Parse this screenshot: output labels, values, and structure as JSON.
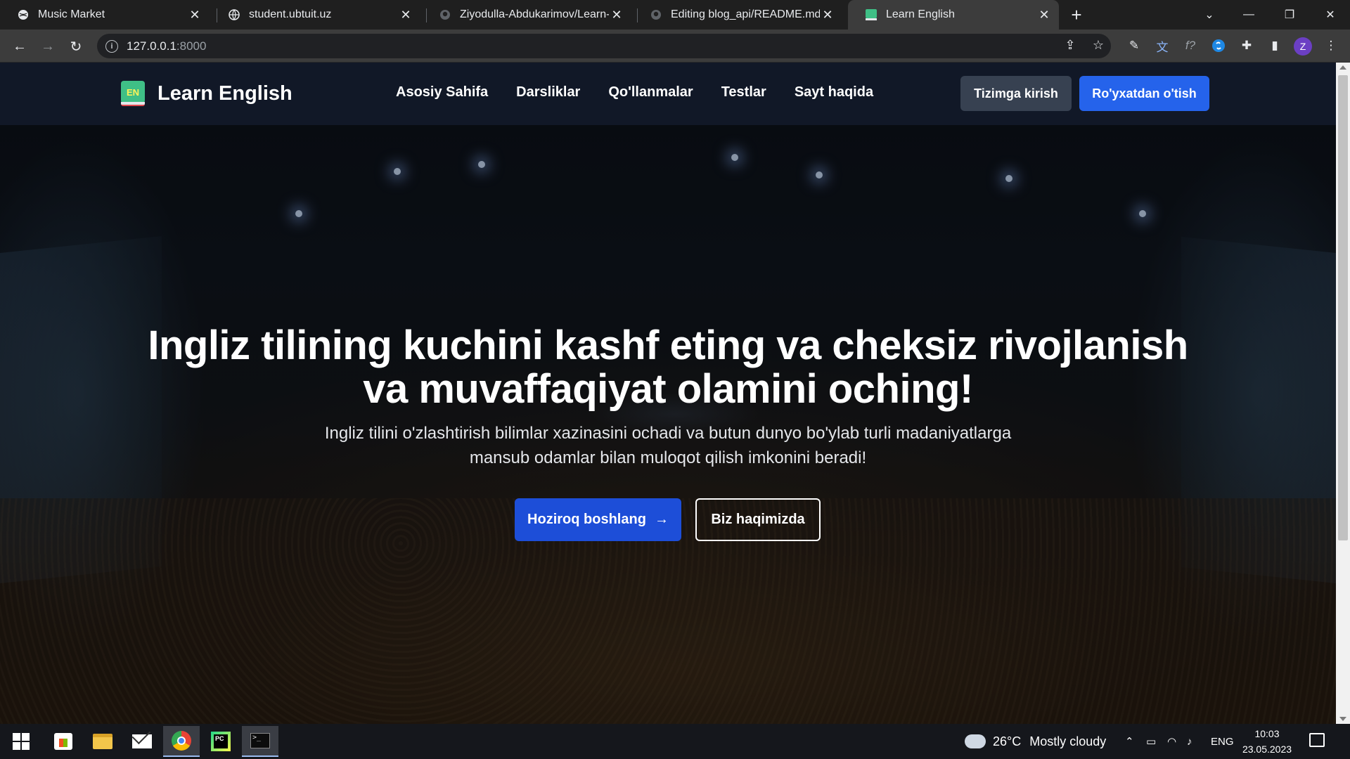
{
  "browser": {
    "tabs": [
      {
        "title": "Music Market",
        "active": false,
        "favicon": "globe-icon"
      },
      {
        "title": "student.ubtuit.uz",
        "active": false,
        "favicon": "globe-icon"
      },
      {
        "title": "Ziyodulla-Abdukarimov/Learn-En",
        "active": false,
        "favicon": "github-icon"
      },
      {
        "title": "Editing blog_api/README.md at",
        "active": false,
        "favicon": "github-icon"
      },
      {
        "title": "Learn English",
        "active": true,
        "favicon": "book-icon"
      }
    ],
    "url_host": "127.0.0.1",
    "url_port": ":8000"
  },
  "site": {
    "brand_logo_text": "EN",
    "brand_name": "Learn English",
    "nav": [
      "Asosiy Sahifa",
      "Darsliklar",
      "Qo'llanmalar",
      "Testlar",
      "Sayt haqida"
    ],
    "login_label": "Tizimga kirish",
    "register_label": "Ro'yxatdan o'tish"
  },
  "hero": {
    "title_line1": "Ingliz tilining kuchini kashf eting va cheksiz rivojlanish",
    "title_line2": "va muvaffaqiyat olamini oching!",
    "subtitle_line1": "Ingliz tilini o'zlashtirish bilimlar xazinasini ochadi va butun dunyo bo'ylab turli madaniyatlarga",
    "subtitle_line2": "mansub odamlar bilan muloqot qilish imkonini beradi!",
    "cta_primary": "Hoziroq boshlang",
    "cta_secondary": "Biz haqimizda"
  },
  "taskbar": {
    "weather_temp": "26°C",
    "weather_desc": "Mostly cloudy",
    "language": "ENG",
    "time": "10:03",
    "date": "23.05.2023"
  },
  "colors": {
    "nav_bg": "#111827",
    "primary": "#2563eb",
    "login_bg": "#374151"
  }
}
